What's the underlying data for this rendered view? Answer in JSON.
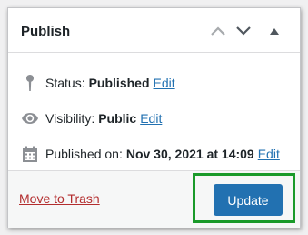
{
  "panel": {
    "title": "Publish",
    "header_icons": [
      "chevron-up-icon",
      "chevron-down-icon",
      "triangle-up-icon"
    ]
  },
  "status": {
    "icon": "pin-icon",
    "label": "Status:",
    "value": "Published",
    "edit_label": "Edit"
  },
  "visibility": {
    "icon": "eye-icon",
    "label": "Visibility:",
    "value": "Public",
    "edit_label": "Edit"
  },
  "published": {
    "icon": "calendar-icon",
    "label": "Published on:",
    "value": "Nov 30, 2021 at 14:09",
    "edit_label": "Edit"
  },
  "footer": {
    "trash_label": "Move to Trash",
    "update_label": "Update"
  },
  "colors": {
    "primary": "#2271b1",
    "danger": "#b32d2e",
    "highlight": "#1a9a2a"
  }
}
